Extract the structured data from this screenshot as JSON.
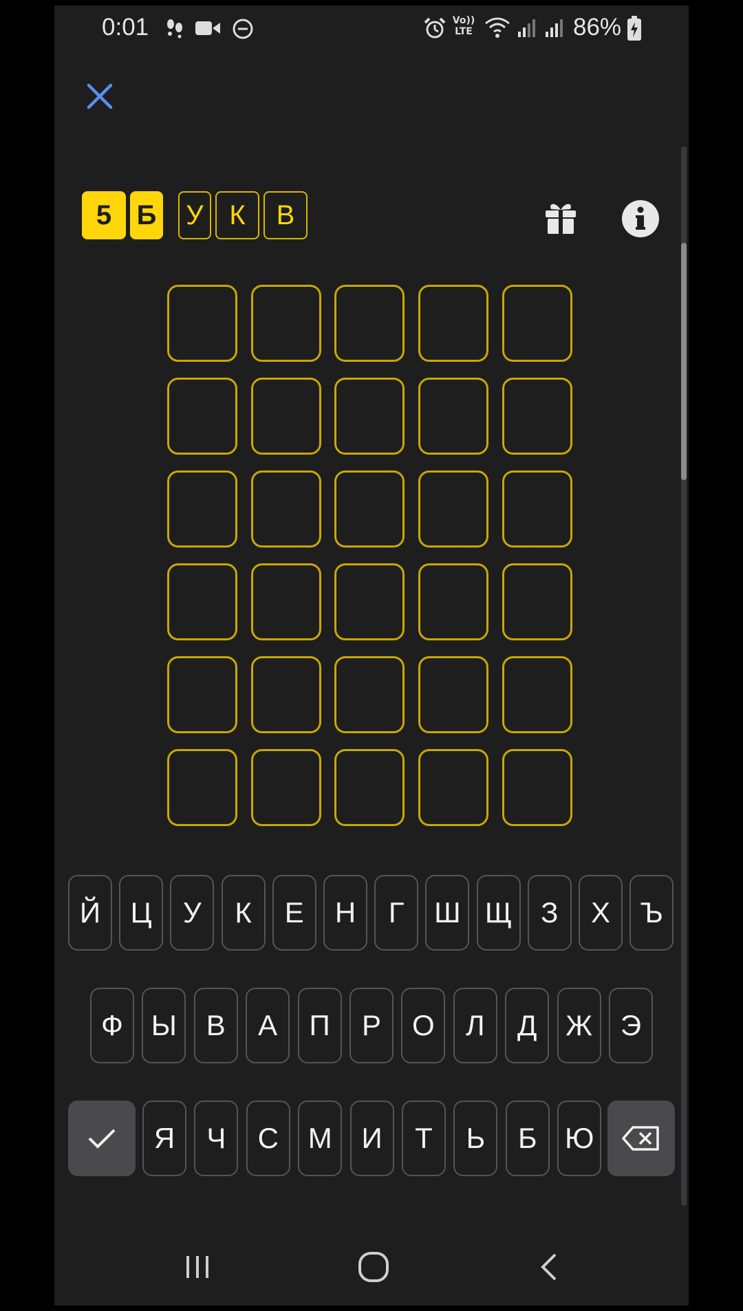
{
  "status_bar": {
    "time": "0:01",
    "battery": "86%",
    "icons": [
      "steps-icon",
      "video-icon",
      "do-not-disturb-icon",
      "alarm-icon",
      "volte-icon",
      "wifi-icon",
      "signal-icon",
      "signal-icon",
      "battery-charging-icon"
    ],
    "volte_label": "Vo)) LTE"
  },
  "header": {
    "close_icon": "close-icon",
    "title_chips": [
      {
        "text": "5",
        "style": "filled"
      },
      {
        "text": "Б",
        "style": "filled"
      },
      {
        "text": "У",
        "style": "outline"
      },
      {
        "text": "К",
        "style": "outline"
      },
      {
        "text": "В",
        "style": "outline"
      }
    ],
    "gift_icon": "gift-icon",
    "info_icon": "info-icon"
  },
  "board": {
    "rows": 6,
    "cols": 5,
    "cells": [
      [
        "",
        "",
        "",
        "",
        ""
      ],
      [
        "",
        "",
        "",
        "",
        ""
      ],
      [
        "",
        "",
        "",
        "",
        ""
      ],
      [
        "",
        "",
        "",
        "",
        ""
      ],
      [
        "",
        "",
        "",
        "",
        ""
      ],
      [
        "",
        "",
        "",
        "",
        ""
      ]
    ],
    "border_color": "#c9a800"
  },
  "keyboard": {
    "row1": [
      "Й",
      "Ц",
      "У",
      "К",
      "Е",
      "Н",
      "Г",
      "Ш",
      "Щ",
      "З",
      "Х",
      "Ъ"
    ],
    "row2": [
      "Ф",
      "Ы",
      "В",
      "А",
      "П",
      "Р",
      "О",
      "Л",
      "Д",
      "Ж",
      "Э"
    ],
    "row3": [
      "Я",
      "Ч",
      "С",
      "М",
      "И",
      "Т",
      "Ь",
      "Б",
      "Ю"
    ],
    "enter_icon": "checkmark-icon",
    "backspace_icon": "backspace-icon"
  },
  "nav_bar": {
    "recents_icon": "recents-icon",
    "home_icon": "home-icon",
    "back_icon": "back-icon"
  },
  "colors": {
    "accent": "#ffd60a",
    "background": "#1e1e1f",
    "close_blue": "#5b8df2"
  }
}
